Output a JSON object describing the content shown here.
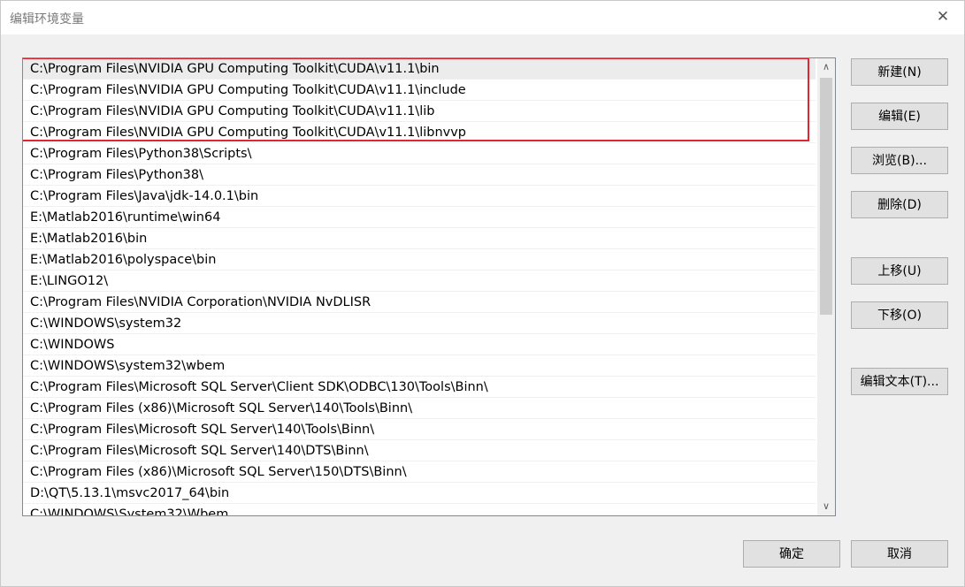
{
  "window": {
    "title": "编辑环境变量",
    "close_glyph": "✕"
  },
  "paths": [
    "C:\\Program Files\\NVIDIA GPU Computing Toolkit\\CUDA\\v11.1\\bin",
    "C:\\Program Files\\NVIDIA GPU Computing Toolkit\\CUDA\\v11.1\\include",
    "C:\\Program Files\\NVIDIA GPU Computing Toolkit\\CUDA\\v11.1\\lib",
    "C:\\Program Files\\NVIDIA GPU Computing Toolkit\\CUDA\\v11.1\\libnvvp",
    "C:\\Program Files\\Python38\\Scripts\\",
    "C:\\Program Files\\Python38\\",
    "C:\\Program Files\\Java\\jdk-14.0.1\\bin",
    "E:\\Matlab2016\\runtime\\win64",
    "E:\\Matlab2016\\bin",
    "E:\\Matlab2016\\polyspace\\bin",
    "E:\\LINGO12\\",
    "C:\\Program Files\\NVIDIA Corporation\\NVIDIA NvDLISR",
    "C:\\WINDOWS\\system32",
    "C:\\WINDOWS",
    "C:\\WINDOWS\\system32\\wbem",
    "C:\\Program Files\\Microsoft SQL Server\\Client SDK\\ODBC\\130\\Tools\\Binn\\",
    "C:\\Program Files (x86)\\Microsoft SQL Server\\140\\Tools\\Binn\\",
    "C:\\Program Files\\Microsoft SQL Server\\140\\Tools\\Binn\\",
    "C:\\Program Files\\Microsoft SQL Server\\140\\DTS\\Binn\\",
    "C:\\Program Files (x86)\\Microsoft SQL Server\\150\\DTS\\Binn\\",
    "D:\\QT\\5.13.1\\msvc2017_64\\bin",
    "C:\\WINDOWS\\System32\\Wbem"
  ],
  "buttons": {
    "new": "新建(N)",
    "edit": "编辑(E)",
    "browse": "浏览(B)...",
    "delete": "删除(D)",
    "move_up": "上移(U)",
    "move_down": "下移(O)",
    "edit_text": "编辑文本(T)...",
    "ok": "确定",
    "cancel": "取消"
  },
  "scrollbar": {
    "up_glyph": "∧",
    "down_glyph": "∨"
  },
  "colors": {
    "highlight_border": "#e0262e",
    "selected_row": "#ececec"
  }
}
